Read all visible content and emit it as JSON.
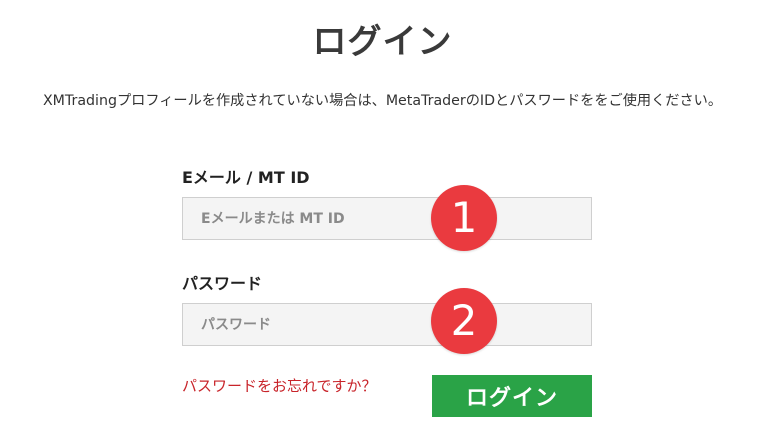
{
  "page": {
    "title": "ログイン",
    "intro": "XMTradingプロフィールを作成されていない場合は、MetaTraderのIDとパスワードををご使用ください。"
  },
  "form": {
    "email": {
      "label": "Eメール / MT ID",
      "placeholder": "Eメールまたは MT ID",
      "value": ""
    },
    "password": {
      "label": "パスワード",
      "placeholder": "パスワード",
      "value": ""
    },
    "forgot_link": "パスワードをお忘れですか？",
    "submit_label": "ログイン"
  },
  "annotations": {
    "step1": "1",
    "step2": "2"
  },
  "colors": {
    "submit_bg": "#2aa347",
    "link": "#c8242a",
    "badge": "#ea3a3f",
    "input_bg": "#f4f4f4"
  }
}
